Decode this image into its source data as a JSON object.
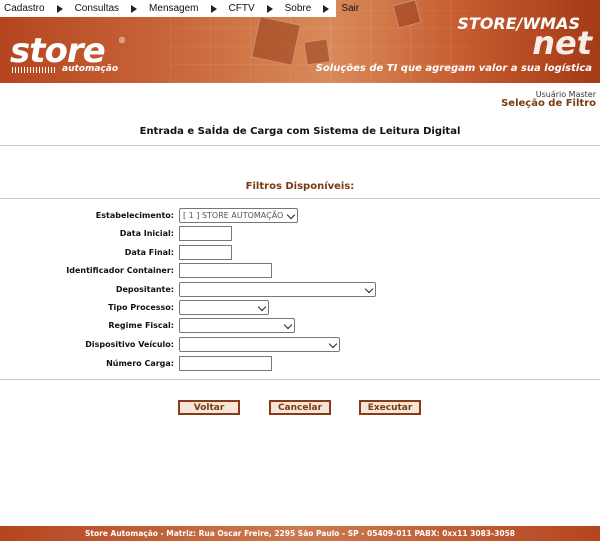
{
  "menu": {
    "items": [
      {
        "label": "Cadastro"
      },
      {
        "label": "Consultas"
      },
      {
        "label": "Mensagem"
      },
      {
        "label": "CFTV"
      },
      {
        "label": "Sobre"
      },
      {
        "label": "Sair"
      }
    ]
  },
  "brand": {
    "logo": "store",
    "logo_sub": "automação",
    "product_title": "STORE/WMAS",
    "product_suffix": "net",
    "tagline": "Soluções de TI que agregam valor a sua logística"
  },
  "header": {
    "user": "Usuário Master",
    "page_title": "Seleção de Filtro"
  },
  "subtitle": "Entrada e SaÍda de Carga com Sistema de Leitura Digital",
  "filters_title": "Filtros Disponíveis:",
  "form": {
    "estabelecimento": {
      "label": "Estabelecimento:",
      "value": "[ 1 ] STORE AUTOMAÇÃO"
    },
    "data_inicial": {
      "label": "Data Inicial:",
      "value": ""
    },
    "data_final": {
      "label": "Data Final:",
      "value": ""
    },
    "identificador_container": {
      "label": "Identificador Container:",
      "value": ""
    },
    "depositante": {
      "label": "Depositante:",
      "value": ""
    },
    "tipo_processo": {
      "label": "Tipo Processo:",
      "value": ""
    },
    "regime_fiscal": {
      "label": "Regime Fiscal:",
      "value": ""
    },
    "dispositivo_veiculo": {
      "label": "Dispositivo Veículo:",
      "value": ""
    },
    "numero_carga": {
      "label": "Número Carga:",
      "value": ""
    }
  },
  "buttons": {
    "voltar": "Voltar",
    "cancelar": "Cancelar",
    "executar": "Executar"
  },
  "footer": "Store Automação - Matriz: Rua Oscar Freire, 2295 São Paulo - SP - 05409-011 PABX: 0xx11 3083-3058"
}
